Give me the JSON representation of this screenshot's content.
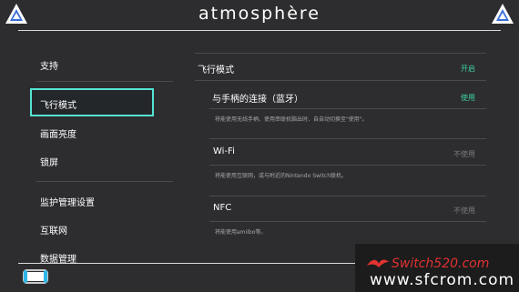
{
  "app": {
    "title": "atmosphère"
  },
  "sidebar": {
    "items": [
      {
        "label": "支持"
      },
      {
        "label": "飞行模式"
      },
      {
        "label": "画面亮度"
      },
      {
        "label": "锁屏"
      },
      {
        "label": "监护管理设置"
      },
      {
        "label": "互联网"
      },
      {
        "label": "数据管理"
      }
    ]
  },
  "main": {
    "airplane": {
      "label": "飞行模式",
      "status": "开启"
    },
    "controller": {
      "label": "与手柄的连接（蓝牙）",
      "status": "使用",
      "desc": "将能使用无线手柄、使用串联机脑出时、自自动切换至\"使用\"。"
    },
    "wifi": {
      "label": "Wi-Fi",
      "status": "不使用",
      "desc": "将能使用互联网，或与附近的Nintendo Switch联机。"
    },
    "nfc": {
      "label": "NFC",
      "status": "不使用",
      "desc": "将能使用amiibo等。"
    }
  },
  "watermark": {
    "site1": "Switch520.com",
    "site2": "www.sfcrom.com"
  },
  "colors": {
    "background": "#2d2d30",
    "accent_cyan": "#55e3d3",
    "status_on": "#3fd49f",
    "status_off": "#7b7b7b",
    "watermark_red": "#e23232"
  },
  "icons": {
    "logo": "atmosphere-logo-icon",
    "console": "switch-console-icon"
  }
}
